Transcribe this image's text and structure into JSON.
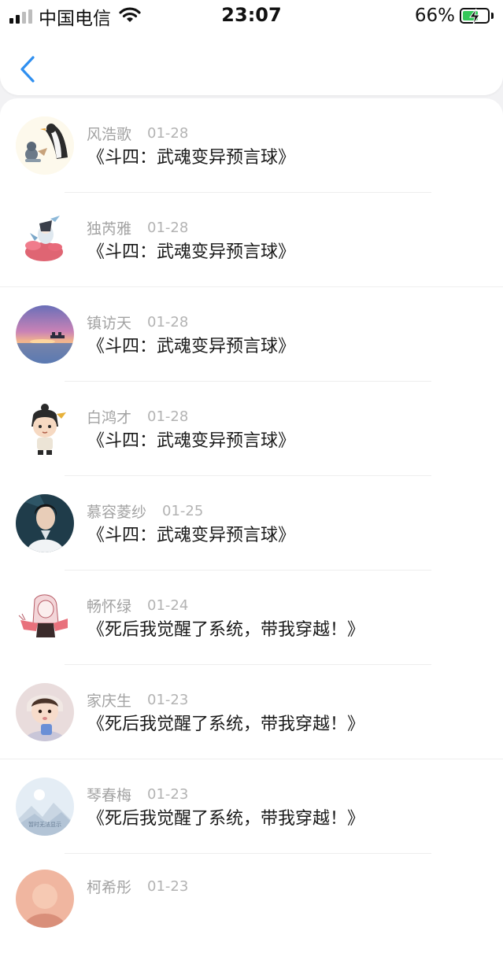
{
  "status_bar": {
    "carrier": "中国电信",
    "time": "23:07",
    "battery_percent": "66%",
    "battery_level": 0.66,
    "icons": [
      "signal-icon",
      "wifi-icon",
      "battery-charging-icon"
    ]
  },
  "nav": {
    "back_icon": "chevron-left-icon",
    "accent_color": "#2f8ff0"
  },
  "comments": [
    {
      "name": "风浩歌",
      "date": "01-28",
      "title": "《斗四：武魂变异预言球》",
      "avatar": "penguin"
    },
    {
      "name": "独芮雅",
      "date": "01-28",
      "title": "《斗四：武魂变异预言球》",
      "avatar": "anime-girl"
    },
    {
      "name": "镇访天",
      "date": "01-28",
      "title": "《斗四：武魂变异预言球》",
      "avatar": "sunset"
    },
    {
      "name": "白鸿才",
      "date": "01-28",
      "title": "《斗四：武魂变异预言球》",
      "avatar": "cartoon-boy"
    },
    {
      "name": "慕容菱纱",
      "date": "01-25",
      "title": "《斗四：武魂变异预言球》",
      "avatar": "man-portrait"
    },
    {
      "name": "畅怀绿",
      "date": "01-24",
      "title": "《死后我觉醒了系统，带我穿越！》",
      "avatar": "sketch-girl"
    },
    {
      "name": "家庆生",
      "date": "01-23",
      "title": "《死后我觉醒了系统，带我穿越！》",
      "avatar": "baby"
    },
    {
      "name": "琴春梅",
      "date": "01-23",
      "title": "《死后我觉醒了系统，带我穿越！》",
      "avatar": "placeholder"
    },
    {
      "name": "柯希彤",
      "date": "01-23",
      "title": "",
      "avatar": "peach"
    }
  ],
  "placeholder_avatar_text": "暂时无法显示"
}
